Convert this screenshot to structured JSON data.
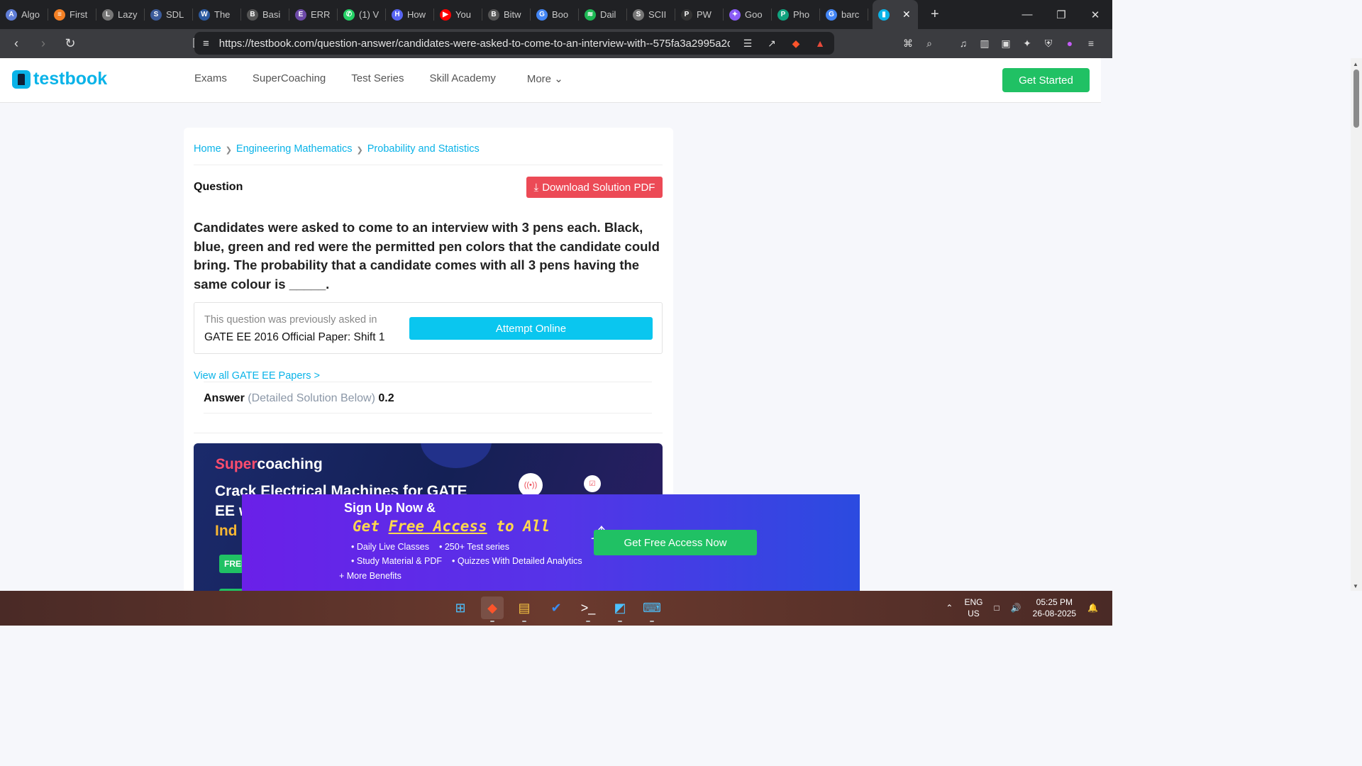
{
  "browser": {
    "tabs": [
      {
        "title": "Algo",
        "color": "#5f7dd6",
        "glyph": "A"
      },
      {
        "title": "First",
        "color": "#f48024",
        "glyph": "≡"
      },
      {
        "title": "Lazy",
        "color": "#777",
        "glyph": "L"
      },
      {
        "title": "SDL",
        "color": "#3b5b9a",
        "glyph": "S"
      },
      {
        "title": "The",
        "color": "#2c5aa0",
        "glyph": "W"
      },
      {
        "title": "Basi",
        "color": "#555",
        "glyph": "B"
      },
      {
        "title": "ERR",
        "color": "#6d4aa8",
        "glyph": "E"
      },
      {
        "title": "(1) V",
        "color": "#25d366",
        "glyph": "✆"
      },
      {
        "title": "How",
        "color": "#5865f2",
        "glyph": "H"
      },
      {
        "title": "You",
        "color": "#ff0000",
        "glyph": "▶"
      },
      {
        "title": "Bitw",
        "color": "#555",
        "glyph": "B"
      },
      {
        "title": "Boo",
        "color": "#4285f4",
        "glyph": "G"
      },
      {
        "title": "Dail",
        "color": "#1db954",
        "glyph": "≋"
      },
      {
        "title": "SCII",
        "color": "#777",
        "glyph": "S"
      },
      {
        "title": "PW",
        "color": "#333",
        "glyph": "P"
      },
      {
        "title": "Goo",
        "color": "#8a5cf6",
        "glyph": "✦"
      },
      {
        "title": "Pho",
        "color": "#10a37f",
        "glyph": "P"
      },
      {
        "title": "barc",
        "color": "#4285f4",
        "glyph": "G"
      }
    ],
    "url": "https://testbook.com/question-answer/candidates-were-asked-to-come-to-an-interview-with--575fa3a2995a2d..."
  },
  "site": {
    "logo": "testbook",
    "nav": [
      "Exams",
      "SuperCoaching",
      "Test Series",
      "Skill Academy"
    ],
    "more": "More",
    "get_started": "Get Started"
  },
  "breadcrumbs": [
    "Home",
    "Engineering Mathematics",
    "Probability and Statistics"
  ],
  "question": {
    "label": "Question",
    "download": "Download Solution PDF",
    "text": "Candidates were asked to come to an interview with 3 pens each. Black, blue, green and red were the permitted pen colors that the candidate could bring. The probability that a candidate comes with all 3 pens having the same colour is _____.",
    "prev_label": "This question was previously asked in",
    "prev_paper": "GATE EE 2016 Official Paper: Shift 1",
    "attempt": "Attempt Online",
    "view_all": "View all GATE EE Papers >",
    "answer_label": "Answer",
    "answer_note": "(Detailed Solution Below)",
    "answer_value": "0.2"
  },
  "banner": {
    "brand_s": "S",
    "brand_rest": "uper",
    "brand_end": "coaching",
    "line1": "Crack Electrical Machines for GATE",
    "line2": "EE w",
    "line3": "Ind",
    "free": "FREE"
  },
  "signup": {
    "title": "Sign Up Now &",
    "sub1": "Get ",
    "sub2": "Free Access",
    "sub3": " to All",
    "items": [
      [
        "Daily Live Classes",
        "250+ Test series"
      ],
      [
        "Study Material & PDF",
        "Quizzes With Detailed Analytics"
      ]
    ],
    "more": "+ More Benefits",
    "cta": "Get Free Access Now"
  },
  "taskbar": {
    "lang1": "ENG",
    "lang2": "US",
    "time": "05:25 PM",
    "date": "26-08-2025"
  },
  "colors": {
    "brand": "#0ab3e8",
    "green": "#20c164",
    "red": "#ec4a56"
  }
}
